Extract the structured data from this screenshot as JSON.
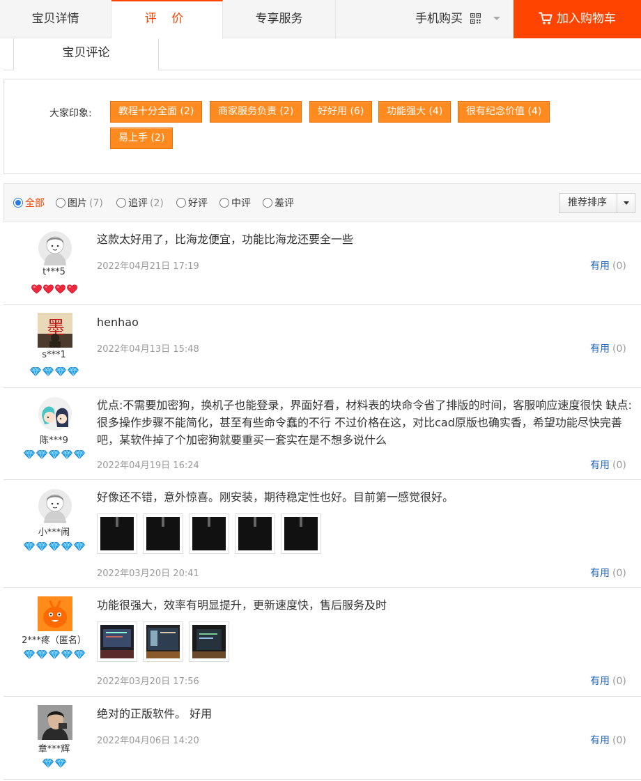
{
  "tabs": {
    "detail": "宝贝详情",
    "reviews": "评 价",
    "service": "专享服务",
    "mobile_buy": "手机购买",
    "add_to_cart": "加入购物车"
  },
  "subtab": "宝贝评论",
  "impressions": {
    "label": "大家印象:",
    "tags": [
      "教程十分全面 (2)",
      "商家服务负责 (2)",
      "好好用 (6)",
      "功能强大 (4)",
      "很有纪念价值 (4)",
      "易上手 (2)"
    ]
  },
  "filters": {
    "all": "全部",
    "pics": "图片",
    "pics_count": "(7)",
    "followup": "追评",
    "followup_count": "(2)",
    "good": "好评",
    "neutral": "中评",
    "bad": "差评",
    "sort": "推荐排序"
  },
  "useful_label": "有用",
  "reviews": [
    {
      "user": "t***5",
      "text": "这款太好用了，比海龙便宜，功能比海龙还要全一些",
      "date": "2022年04月21日 17:19",
      "useful": "(0)",
      "rank": "4 hearts"
    },
    {
      "user": "s***1",
      "text": "henhao",
      "date": "2022年04月13日 15:48",
      "useful": "(0)",
      "rank": "4 diamonds"
    },
    {
      "user": "陈***9",
      "text": "优点:不需要加密狗，换机子也能登录，界面好看，材料表的块命令省了排版的时间，客服响应速度很快 缺点:很多操作步骤不能简化，甚至有些命令蠢的不行 不过价格在这，对比cad原版也确实香，希望功能尽快完善吧，某软件掉了个加密狗就要重买一套实在是不想多说什么",
      "date": "2022年04月19日 16:24",
      "useful": "(0)",
      "rank": "5 diamonds"
    },
    {
      "user": "小***闹",
      "text": "好像还不错，意外惊喜。刚安装，期待稳定性也好。目前第一感觉很好。",
      "date": "2022年03月20日 20:41",
      "useful": "(0)",
      "rank": "5 diamonds"
    },
    {
      "user": "2***疼（匿名）",
      "text": "功能很强大，效率有明显提升，更新速度快，售后服务及时",
      "date": "2022年03月20日 17:56",
      "useful": "(0)",
      "rank": "5 diamonds"
    },
    {
      "user": "章***辉",
      "text": "绝对的正版软件。 好用",
      "date": "2022年04月06日 14:20",
      "useful": "(0)",
      "rank": "2 diamonds"
    }
  ],
  "colors": {
    "accent": "#ff4400",
    "tag_bg": "#ff8a1f",
    "link": "#2266bb",
    "radio": "#2a7be4"
  },
  "icons": [
    "qr-code-icon",
    "cart-icon",
    "heart-icon",
    "diamond-icon",
    "default-avatar-icon"
  ]
}
